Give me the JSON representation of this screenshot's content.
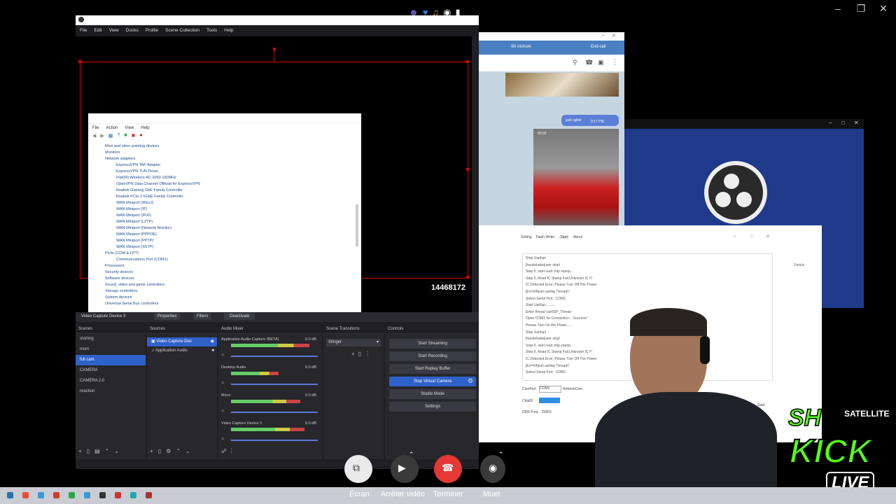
{
  "status_icons": [
    "game-controller-icon",
    "heart-icon",
    "guitar-icon",
    "record-icon",
    "signal-icon"
  ],
  "obs": {
    "menu": [
      "File",
      "Edit",
      "View",
      "Docks",
      "Profile",
      "Scene Collection",
      "Tools",
      "Help"
    ],
    "counter": "14468172",
    "source_bar": {
      "source": "Video Capture Device 3",
      "properties": "Properties",
      "filters": "Filters",
      "deactivate": "Deactivate"
    },
    "scenes": {
      "title": "Scenes",
      "items": [
        "starting",
        "msm",
        "full cam",
        "CAMERA",
        "CAMERA 2.0",
        "reaction"
      ],
      "selected_index": 2
    },
    "sources": {
      "title": "Sources",
      "items": [
        "Video Capture Dev",
        "Application Audio"
      ]
    },
    "mixer": {
      "title": "Audio Mixer",
      "channels": [
        {
          "name": "Application Audio Capture (BETA)",
          "db": "0.0 dB",
          "level": 0.9
        },
        {
          "name": "Desktop Audio",
          "db": "0.0 dB",
          "level": 0.55
        },
        {
          "name": "Micro",
          "db": "0.0 dB",
          "level": 0.8
        },
        {
          "name": "Video Capture Device 3",
          "db": "0.0 dB",
          "level": 0.85
        }
      ]
    },
    "transitions": {
      "title": "Scene Transitions",
      "value": "Stinger"
    },
    "controls": {
      "title": "Controls",
      "buttons": [
        "Start Streaming",
        "Start Recording",
        "Start Replay Buffer",
        "Stop Virtual Camera",
        "Studio Mode",
        "Settings"
      ],
      "active_index": 3
    }
  },
  "device_manager": {
    "menu": [
      "File",
      "Action",
      "View",
      "Help"
    ],
    "tree": [
      "Mice and other pointing devices",
      "Monitors",
      "Network adapters",
      "ExpressVPN TAP Adapter",
      "ExpressVPN TUN Driver",
      "Intel(R) Wireless-AC 9260 160MHz",
      "OpenVPN Data Channel Offload for ExpressVPN",
      "Realtek Gaming GbE Family Controller",
      "Realtek PCIe 2.5GbE Family Controller",
      "WAN Miniport (IKEv2)",
      "WAN Miniport (IP)",
      "WAN Miniport (IPv6)",
      "WAN Miniport (L2TP)",
      "WAN Miniport (Network Monitor)",
      "WAN Miniport (PPPOE)",
      "WAN Miniport (PPTP)",
      "WAN Miniport (SSTP)",
      "Ports (COM & LPT)",
      "Communications Port (COM1)",
      "Processors",
      "Security devices",
      "Software devices",
      "Sound, video and game controllers",
      "Storage controllers",
      "System devices",
      "Universal Serial Bus controllers"
    ]
  },
  "call": {
    "contact": "Sh trichom",
    "end_call": "End call",
    "message_text": "jack sgher",
    "message_time": "9:17 PM",
    "video_duration": "00:02"
  },
  "tool": {
    "tabs": [
      "Setting",
      "Flash Writer",
      "Start",
      "About"
    ],
    "log": [
      "Stop UartIsp!",
      "[handshake]user stop!",
      "Step 0, start read chip stamp...",
      "Step 0, Read IC Stamp Fail,Unknown IC !!!",
      "IC Detected Error, Please Turn Off The Power",
      "[Err=64]exit uartisp Thread!!",
      "Select Serial Port : COM1",
      "Start UartIsp.........",
      "Enter thread UartISP_Thread",
      "Open COM1 for Connection... Success!",
      "Please Turn On the Power......",
      "Stop UartIsp!",
      "[handshake]user stop!",
      "Step 0, start read chip stamp...",
      "Step 0, Read IC Stamp Fail,Unknown IC !!!",
      "IC Detected Error, Please Turn Off The Power",
      "[Err=64]exit uartisp Thread!!",
      "Select Serial Port : COM1"
    ],
    "com_port_label": "ComPort",
    "com_port_value": "COM1",
    "refresh": "RefreshCom",
    "chip_label": "ChipID",
    "ddr_label": "DDR Freq",
    "ddr_value": "DDR3",
    "start": "Start",
    "details": "Details"
  },
  "call_controls": [
    {
      "label": "Écran",
      "icon": "screen-share-icon"
    },
    {
      "label": "Arrêter vidéo",
      "icon": "video-camera-icon"
    },
    {
      "label": "Terminer",
      "icon": "hang-up-icon"
    },
    {
      "label": "Muet",
      "icon": "microphone-icon"
    }
  ],
  "overlay": {
    "brand1": "SH",
    "brand2": "SATELLITE",
    "kick": "KICK",
    "live": "LIVE"
  },
  "colors": {
    "accent": "#2f62c9",
    "record_red": "#d00",
    "hangup": "#e53935",
    "kick_green": "#53fc18"
  }
}
